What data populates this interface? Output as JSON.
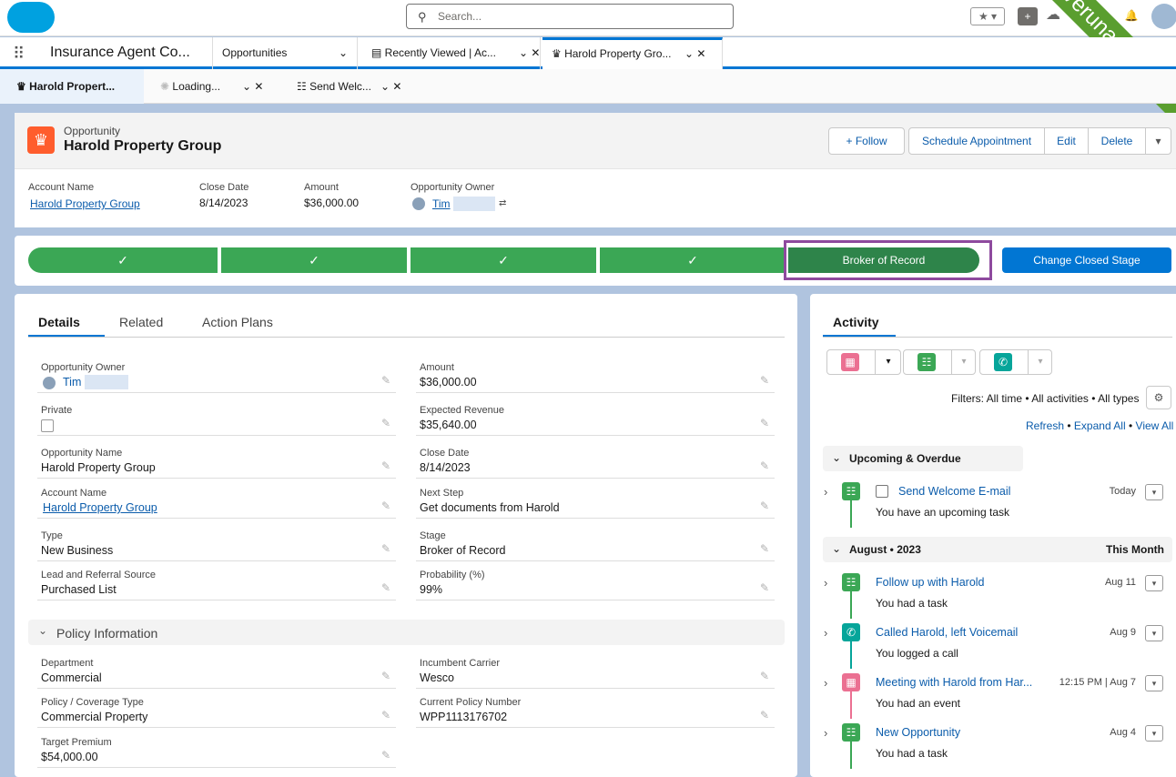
{
  "search": {
    "placeholder": "Search..."
  },
  "nav": {
    "app_name": "Insurance Agent Co...",
    "tabs": [
      {
        "label": "Opportunities"
      },
      {
        "label": "Recently Viewed | Ac..."
      },
      {
        "label": "Harold Property Gro..."
      }
    ]
  },
  "subtabs": [
    {
      "label": "Harold Propert..."
    },
    {
      "label": "Loading..."
    },
    {
      "label": "Send Welc..."
    }
  ],
  "banner": "Veruna Demo",
  "header": {
    "object": "Opportunity",
    "name": "Harold Property Group",
    "buttons": {
      "follow": "+ Follow",
      "schedule": "Schedule Appointment",
      "edit": "Edit",
      "delete": "Delete"
    },
    "fields": [
      {
        "label": "Account Name",
        "value": "Harold Property Group"
      },
      {
        "label": "Close Date",
        "value": "8/14/2023"
      },
      {
        "label": "Amount",
        "value": "$36,000.00"
      },
      {
        "label": "Opportunity Owner",
        "value": "Tim"
      }
    ]
  },
  "path": {
    "completed_mark": "✓",
    "current": "Broker of Record",
    "button": "Change Closed Stage"
  },
  "details": {
    "tabs": [
      "Details",
      "Related",
      "Action Plans"
    ],
    "left": [
      {
        "label": "Opportunity Owner",
        "value": "Tim"
      },
      {
        "label": "Private",
        "value": ""
      },
      {
        "label": "Opportunity Name",
        "value": "Harold Property Group"
      },
      {
        "label": "Account Name",
        "value": "Harold Property Group"
      },
      {
        "label": "Type",
        "value": "New Business"
      },
      {
        "label": "Lead and Referral Source",
        "value": "Purchased List"
      }
    ],
    "right": [
      {
        "label": "Amount",
        "value": "$36,000.00"
      },
      {
        "label": "Expected Revenue",
        "value": "$35,640.00"
      },
      {
        "label": "Close Date",
        "value": "8/14/2023"
      },
      {
        "label": "Next Step",
        "value": "Get documents from Harold"
      },
      {
        "label": "Stage",
        "value": "Broker of Record"
      },
      {
        "label": "Probability (%)",
        "value": "99%"
      }
    ],
    "section": "Policy Information",
    "policy_left": [
      {
        "label": "Department",
        "value": "Commercial"
      },
      {
        "label": "Policy / Coverage Type",
        "value": "Commercial Property"
      },
      {
        "label": "Target Premium",
        "value": "$54,000.00"
      }
    ],
    "policy_right": [
      {
        "label": "Incumbent Carrier",
        "value": "Wesco"
      },
      {
        "label": "Current Policy Number",
        "value": "WPP1113176702"
      }
    ]
  },
  "activity": {
    "title": "Activity",
    "filters": "Filters: All time • All activities • All types",
    "refresh": "Refresh",
    "expand": "Expand All",
    "view_all": "View All",
    "sep": "•",
    "upcoming": "Upcoming & Overdue",
    "august": "August • 2023",
    "this_month": "This Month",
    "items": [
      {
        "title": "Send Welcome E-mail",
        "sub": "You have an upcoming task",
        "date": "Today"
      },
      {
        "title": "Follow up with Harold",
        "sub": "You had a task",
        "date": "Aug 11"
      },
      {
        "title": "Called Harold, left Voicemail",
        "sub": "You logged a call",
        "date": "Aug 9"
      },
      {
        "title": "Meeting with Harold from Har...",
        "sub": "You had an event",
        "date": "12:15 PM | Aug 7"
      },
      {
        "title": "New Opportunity",
        "sub": "You had a task",
        "date": "Aug 4"
      }
    ]
  },
  "colors": {
    "brand": "#0176d3",
    "path_complete": "#3ba755",
    "path_current": "#2e844a",
    "highlight": "#8e4a9e",
    "opportunity_icon": "#ff5d2d"
  }
}
